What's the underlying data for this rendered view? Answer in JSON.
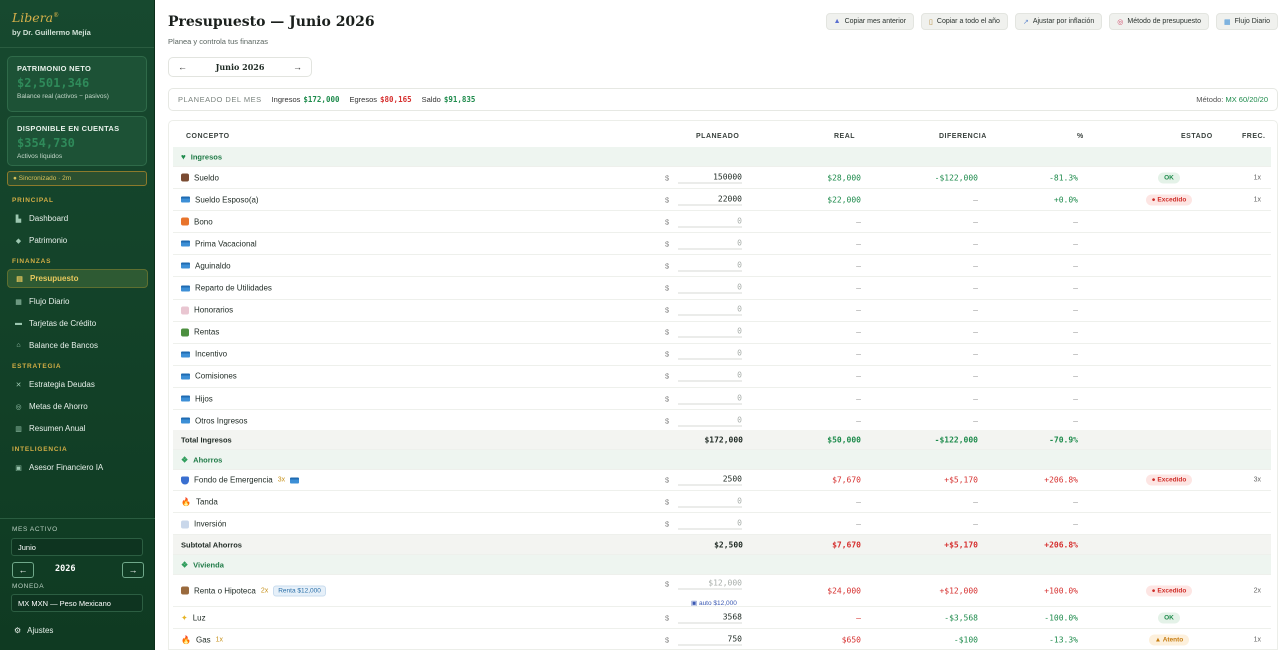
{
  "brand": {
    "name": "Libera",
    "mark": "®",
    "author": "by Dr. Guillermo Mejía"
  },
  "cards": {
    "net_worth": {
      "title": "PATRIMONIO NETO",
      "value": "$2,501,346",
      "sub": "Balance real (activos − pasivos)"
    },
    "available": {
      "title": "DISPONIBLE EN CUENTAS",
      "value": "$354,730",
      "sub": "Activos líquidos"
    }
  },
  "sync": "● Sincronizado · 2m",
  "nav": {
    "principal": "PRINCIPAL",
    "finanzas": "FINANZAS",
    "estrategia": "ESTRATEGIA",
    "inteligencia": "INTELIGENCIA",
    "items": [
      {
        "label": "Dashboard",
        "icon": "chart-bars-icon"
      },
      {
        "label": "Patrimonio",
        "icon": "diamond-icon"
      },
      {
        "label": "Presupuesto",
        "icon": "clipboard-icon"
      },
      {
        "label": "Flujo Diario",
        "icon": "calendar-icon"
      },
      {
        "label": "Tarjetas de Crédito",
        "icon": "credit-card-icon"
      },
      {
        "label": "Balance de Bancos",
        "icon": "bank-icon"
      },
      {
        "label": "Estrategia Deudas",
        "icon": "swords-icon"
      },
      {
        "label": "Metas de Ahorro",
        "icon": "target-icon"
      },
      {
        "label": "Resumen Anual",
        "icon": "bar-chart-icon"
      },
      {
        "label": "Asesor Financiero IA",
        "icon": "robot-icon"
      }
    ]
  },
  "sidebar_bottom": {
    "month_label": "MES ACTIVO",
    "month_value": "Junio",
    "year": "2026",
    "prev": "←",
    "next": "→",
    "currency_label": "MONEDA",
    "currency_value": "MX MXN — Peso Mexicano",
    "settings": "Ajustes"
  },
  "header": {
    "title": "Presupuesto — Junio 2026",
    "subtitle": "Planea y controla tus finanzas",
    "actions": [
      "Copiar mes anterior",
      "Copiar a todo el año",
      "Ajustar por inflación",
      "Método de presupuesto",
      "Flujo Diario"
    ],
    "month_nav": {
      "prev": "←",
      "label": "Junio 2026",
      "next": "→"
    }
  },
  "summary": {
    "label": "PLANEADO DEL MES",
    "income_label": "Ingresos",
    "income": "$172,000",
    "expense_label": "Egresos",
    "expense": "$80,165",
    "balance_label": "Saldo",
    "balance": "$91,835",
    "method_label": "Método:",
    "method_value": "MX 60/20/20"
  },
  "table": {
    "headers": {
      "concept": "CONCEPTO",
      "plan": "PLANEADO",
      "real": "REAL",
      "diff": "DIFERENCIA",
      "pct": "%",
      "state": "ESTADO",
      "freq": "FREC."
    },
    "currency": "$",
    "groups": {
      "income": "Ingresos",
      "savings": "Ahorros",
      "housing": "Vivienda"
    },
    "rows": [
      {
        "concept": "Sueldo",
        "plan": "150000",
        "real": "$28,000",
        "diff": "-$122,000",
        "pct": "-81.3%",
        "state": "OK",
        "freq": "1x"
      },
      {
        "concept": "Sueldo Esposo(a)",
        "plan": "22000",
        "real": "$22,000",
        "diff": "—",
        "pct": "+0.0%",
        "state": "Excedido",
        "freq": "1x"
      },
      {
        "concept": "Bono",
        "plan": "0",
        "real": "—",
        "diff": "—",
        "pct": "—"
      },
      {
        "concept": "Prima Vacacional",
        "plan": "0",
        "real": "—",
        "diff": "—",
        "pct": "—"
      },
      {
        "concept": "Aguinaldo",
        "plan": "0",
        "real": "—",
        "diff": "—",
        "pct": "—"
      },
      {
        "concept": "Reparto de Utilidades",
        "plan": "0",
        "real": "—",
        "diff": "—",
        "pct": "—"
      },
      {
        "concept": "Honorarios",
        "plan": "0",
        "real": "—",
        "diff": "—",
        "pct": "—"
      },
      {
        "concept": "Rentas",
        "plan": "0",
        "real": "—",
        "diff": "—",
        "pct": "—"
      },
      {
        "concept": "Incentivo",
        "plan": "0",
        "real": "—",
        "diff": "—",
        "pct": "—"
      },
      {
        "concept": "Comisiones",
        "plan": "0",
        "real": "—",
        "diff": "—",
        "pct": "—"
      },
      {
        "concept": "Hijos",
        "plan": "0",
        "real": "—",
        "diff": "—",
        "pct": "—"
      },
      {
        "concept": "Otros Ingresos",
        "plan": "0",
        "real": "—",
        "diff": "—",
        "pct": "—"
      }
    ],
    "income_total": {
      "label": "Total Ingresos",
      "plan": "$172,000",
      "real": "$50,000",
      "diff": "-$122,000",
      "pct": "-70.9%"
    },
    "savings_rows": [
      {
        "concept": "Fondo de Emergencia",
        "tag": "3x",
        "plan": "2500",
        "real": "$7,670",
        "diff": "+$5,170",
        "pct": "+206.8%",
        "state": "Excedido",
        "freq": "3x"
      },
      {
        "concept": "Tanda",
        "plan": "0",
        "real": "—",
        "diff": "—",
        "pct": "—"
      },
      {
        "concept": "Inversión",
        "plan": "0",
        "real": "—",
        "diff": "—",
        "pct": "—"
      }
    ],
    "savings_total": {
      "label": "Subtotal Ahorros",
      "plan": "$2,500",
      "real": "$7,670",
      "diff": "+$5,170",
      "pct": "+206.8%"
    },
    "housing_rows": [
      {
        "concept": "Renta o Hipoteca",
        "tag": "2x",
        "tag_box": "Renta $12,000",
        "plan": "$12,000",
        "auto": "auto $12,000",
        "real": "$24,000",
        "diff": "+$12,000",
        "pct": "+100.0%",
        "state": "Excedido",
        "freq": "2x"
      },
      {
        "concept": "Luz",
        "plan": "3568",
        "real": "—",
        "diff": "-$3,568",
        "pct": "-100.0%",
        "state": "OK"
      },
      {
        "concept": "Gas",
        "tag": "1x",
        "plan": "750",
        "real": "$650",
        "diff": "-$100",
        "pct": "-13.3%",
        "state": "Atento",
        "freq": "1x"
      }
    ]
  },
  "colors": {
    "sidebar": "#17492f",
    "accent_gold": "#d5b04a",
    "positive": "#1e8b4c",
    "negative": "#d6302f"
  }
}
